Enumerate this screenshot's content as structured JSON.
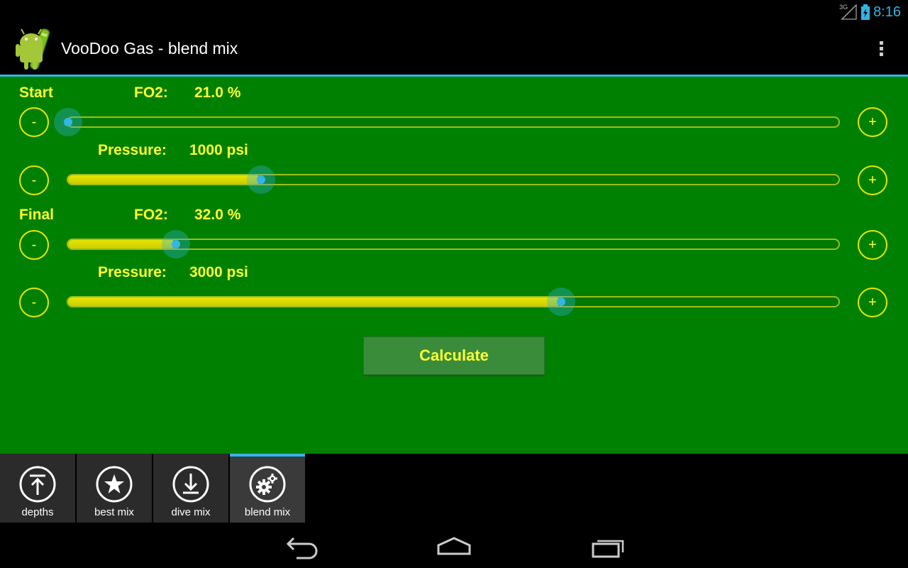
{
  "status_bar": {
    "time": "8:16",
    "network": "3G"
  },
  "action_bar": {
    "title": "VooDoo Gas - blend mix"
  },
  "start": {
    "section_label": "Start",
    "fo2_label": "FO2:",
    "fo2_value": "21.0 %",
    "fo2_slider_fraction": 0.0,
    "pressure_label": "Pressure:",
    "pressure_value": "1000 psi",
    "pressure_slider_fraction": 0.25
  },
  "final": {
    "section_label": "Final",
    "fo2_label": "FO2:",
    "fo2_value": "32.0 %",
    "fo2_slider_fraction": 0.14,
    "pressure_label": "Pressure:",
    "pressure_value": "3000 psi",
    "pressure_slider_fraction": 0.64
  },
  "buttons": {
    "minus": "-",
    "plus": "+",
    "calculate": "Calculate"
  },
  "tabs": [
    {
      "label": "depths",
      "icon": "upload-icon",
      "selected": false
    },
    {
      "label": "best mix",
      "icon": "star-icon",
      "selected": false
    },
    {
      "label": "dive mix",
      "icon": "download-icon",
      "selected": false
    },
    {
      "label": "blend mix",
      "icon": "gears-icon",
      "selected": true
    }
  ],
  "colors": {
    "background": "#008000",
    "accent": "#33b5e5",
    "label": "#ffff33"
  }
}
